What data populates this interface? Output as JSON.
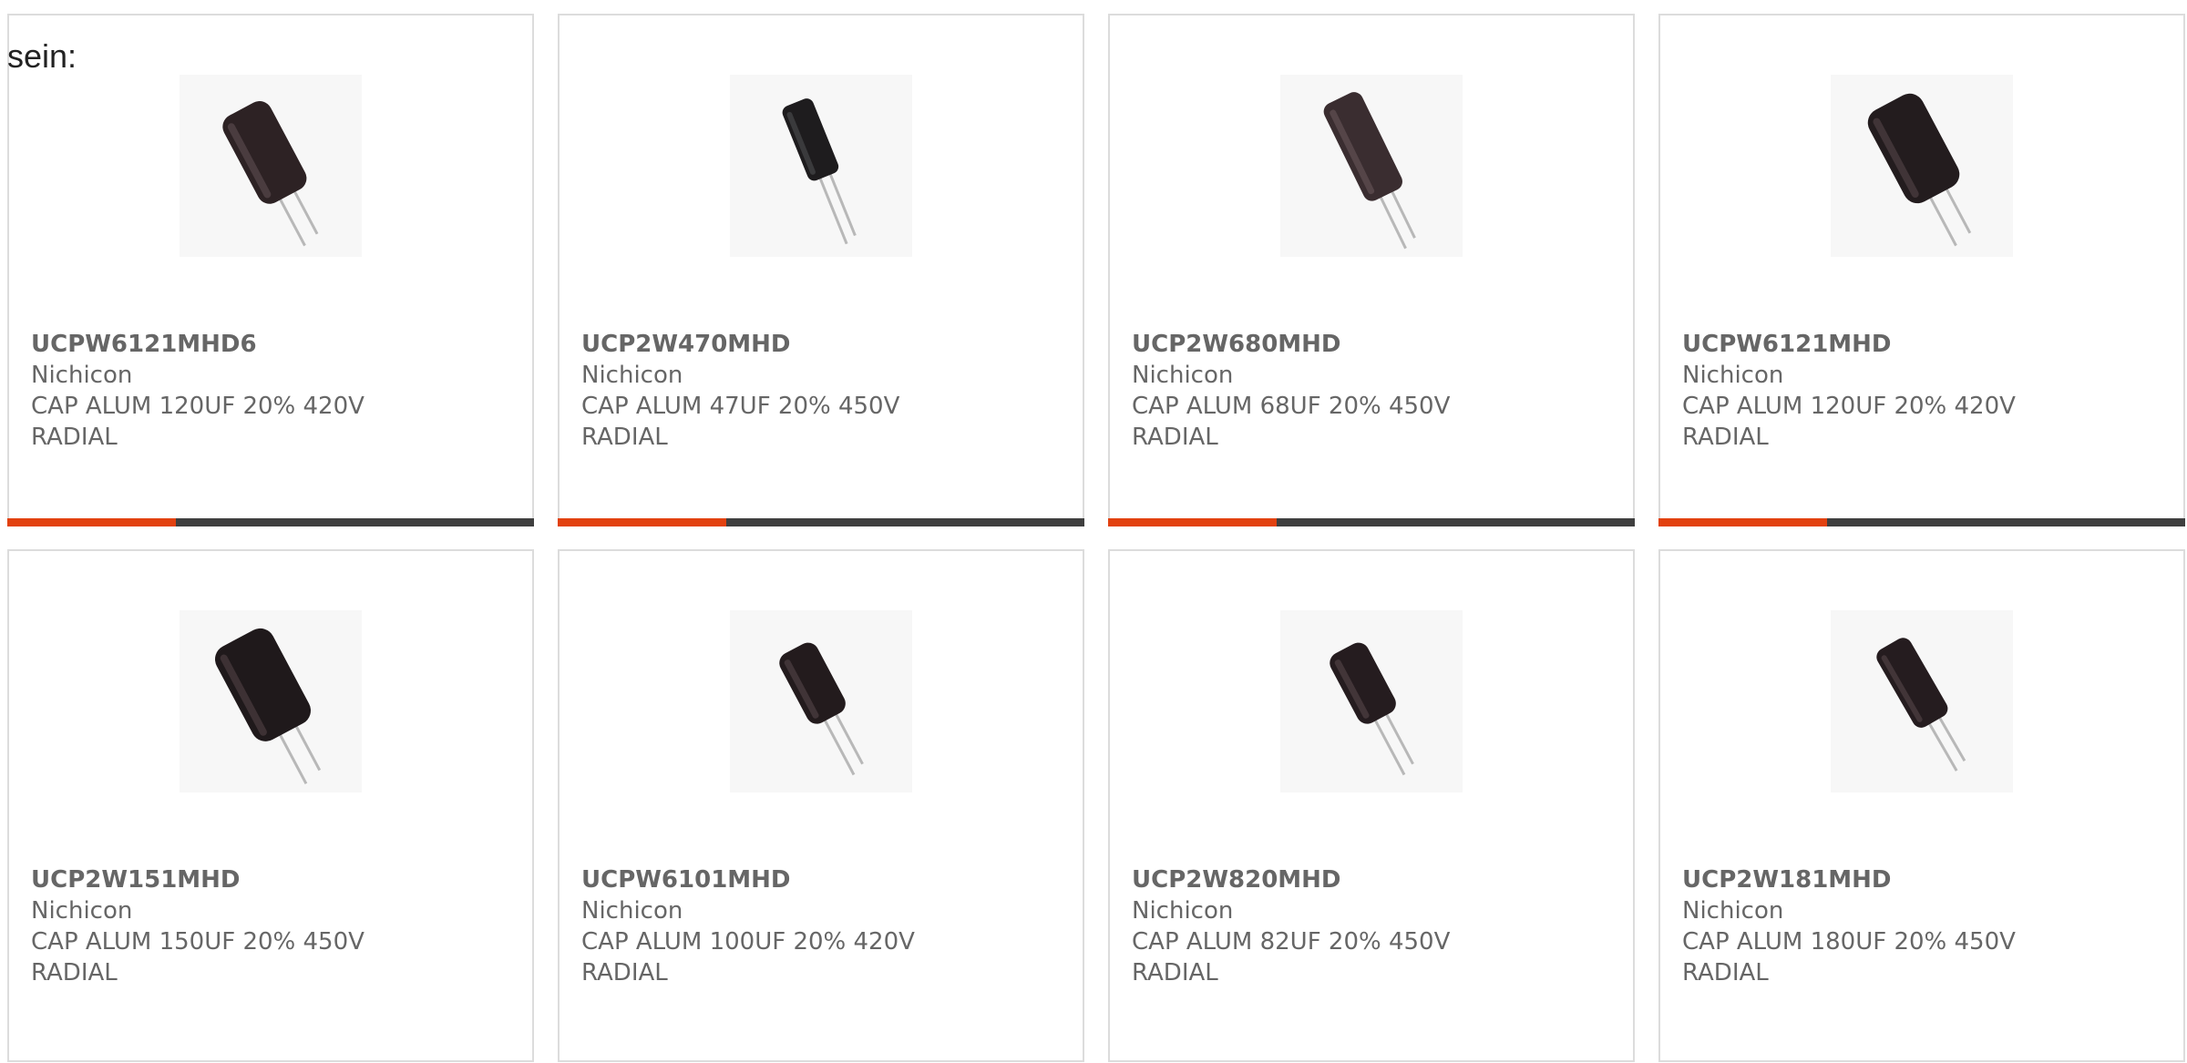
{
  "intro_text": "sein:",
  "accent_color": "#e2410f",
  "track_color": "#3f3f3f",
  "cards": [
    {
      "part_no": "UCPW6121MHD6",
      "manufacturer": "Nichicon",
      "desc1": "CAP ALUM 120UF 20% 420V",
      "desc2": "RADIAL",
      "progress": 0.32,
      "icon": "capacitor-icon"
    },
    {
      "part_no": "UCP2W470MHD",
      "manufacturer": "Nichicon",
      "desc1": "CAP ALUM 47UF 20% 450V",
      "desc2": "RADIAL",
      "progress": 0.32,
      "icon": "capacitor-icon"
    },
    {
      "part_no": "UCP2W680MHD",
      "manufacturer": "Nichicon",
      "desc1": "CAP ALUM 68UF 20% 450V",
      "desc2": "RADIAL",
      "progress": 0.32,
      "icon": "capacitor-icon"
    },
    {
      "part_no": "UCPW6121MHD",
      "manufacturer": "Nichicon",
      "desc1": "CAP ALUM 120UF 20% 420V",
      "desc2": "RADIAL",
      "progress": 0.32,
      "icon": "capacitor-icon"
    },
    {
      "part_no": "UCP2W151MHD",
      "manufacturer": "Nichicon",
      "desc1": "CAP ALUM 150UF 20% 450V",
      "desc2": "RADIAL",
      "progress": null,
      "icon": "capacitor-icon"
    },
    {
      "part_no": "UCPW6101MHD",
      "manufacturer": "Nichicon",
      "desc1": "CAP ALUM 100UF 20% 420V",
      "desc2": "RADIAL",
      "progress": null,
      "icon": "capacitor-icon"
    },
    {
      "part_no": "UCP2W820MHD",
      "manufacturer": "Nichicon",
      "desc1": "CAP ALUM 82UF 20% 450V",
      "desc2": "RADIAL",
      "progress": null,
      "icon": "capacitor-icon"
    },
    {
      "part_no": "UCP2W181MHD",
      "manufacturer": "Nichicon",
      "desc1": "CAP ALUM 180UF 20% 450V",
      "desc2": "RADIAL",
      "progress": null,
      "icon": "capacitor-icon"
    }
  ]
}
